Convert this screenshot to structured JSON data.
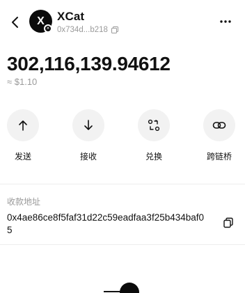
{
  "header": {
    "token_name": "XCat",
    "token_short_address": "0x734d...b218",
    "avatar_letter": "X",
    "chain_badge_glyph": "×"
  },
  "balance": {
    "amount": "302,116,139.94612",
    "fiat_value": "≈ $1.10"
  },
  "actions": [
    {
      "label": "发送",
      "icon": "arrow-up-icon"
    },
    {
      "label": "接收",
      "icon": "arrow-down-icon"
    },
    {
      "label": "兑换",
      "icon": "swap-icon"
    },
    {
      "label": "跨链桥",
      "icon": "bridge-link-icon"
    }
  ],
  "receive": {
    "title": "收款地址",
    "address": "0x4ae86ce8f5faf31d22c59eadfaa3f25b434baf05"
  },
  "colors": {
    "text": "#111111",
    "muted": "#9a9a9a",
    "circle_bg": "#f2f2f2",
    "divider": "#ededed"
  }
}
